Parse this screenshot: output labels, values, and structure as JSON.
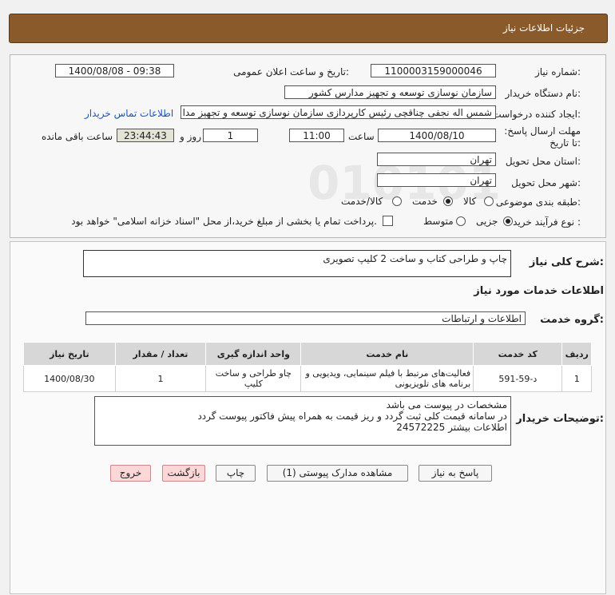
{
  "header": {
    "title": "جزئیات اطلاعات نیاز"
  },
  "fields": {
    "need_number_label": "شماره نیاز:",
    "need_number": "1100003159000046",
    "announce_label": "تاریخ و ساعت اعلان عمومی:",
    "announce_value": "1400/08/08 - 09:38",
    "buyer_label": "نام دستگاه خریدار:",
    "buyer_value": "سازمان نوسازی  توسعه و تجهیز مدارس کشور",
    "creator_label": "ایجاد کننده درخواست:",
    "creator_value": "شمس اله نجفی چناقچی رئیس کارپردازی سازمان نوسازی  توسعه و تجهیز مدا",
    "contact_link": "اطلاعات تماس خریدار",
    "deadline_label": "مهلت ارسال پاسخ: تا تاریخ:",
    "deadline_date": "1400/08/10",
    "time_label": "ساعت",
    "deadline_time": "11:00",
    "days_value": "1",
    "days_label": "روز و",
    "remaining_value": "23:44:43",
    "remaining_label": "ساعت باقی مانده",
    "province_label": "استان محل تحویل:",
    "province_value": "تهران",
    "city_label": "شهر محل تحویل:",
    "city_value": "تهران",
    "category_label": "طبقه بندی موضوعی:",
    "category_options": [
      "کالا",
      "خدمت",
      "کالا/خدمت"
    ],
    "category_selected": "خدمت",
    "process_label": "نوع فرآیند خرید :",
    "process_options": [
      "جزیی",
      "متوسط"
    ],
    "process_selected": "جزیی",
    "payment_note": "پرداخت تمام یا بخشی از مبلغ خرید،از محل \"اسناد خزانه اسلامی\" خواهد بود."
  },
  "details": {
    "general_label": "شرح کلی نیاز:",
    "general_value": "چاپ و طراحی  کتاب و ساخت  2 کلیپ تصویری",
    "services_heading": "اطلاعات خدمات مورد نیاز",
    "group_label": "گروه خدمت:",
    "group_value": "اطلاعات و ارتباطات"
  },
  "table": {
    "headers": [
      "ردیف",
      "کد خدمت",
      "نام خدمت",
      "واحد اندازه گیری",
      "تعداد / مقدار",
      "تاریخ نیاز"
    ],
    "rows": [
      [
        "1",
        "د-59-591",
        "فعالیت‌های مرتبط با فیلم سینمایی، ویدیویی و برنامه های تلویزیونی",
        "چاو طراحی و ساخت کلیپ",
        "1",
        "1400/08/30"
      ]
    ]
  },
  "buyer_notes": {
    "label": "توضیحات خریدار:",
    "line1": "مشخصات در پیوست می باشد",
    "line2": "در سامانه قیمت کلی ثبت گردد و ریز قیمت به همراه پیش فاکتور پیوست گردد",
    "line3": "اطلاعات بیشتر 24572225"
  },
  "buttons": {
    "reply": "پاسخ به نیاز",
    "attachments": "مشاهده مدارک پیوستی (1)",
    "print": "چاپ",
    "back": "بازگشت",
    "exit": "خروج"
  },
  "colors": {
    "header_bg": "#8b5a2b",
    "link": "#1a56b8",
    "exit_bg": "#fbd7d7"
  }
}
